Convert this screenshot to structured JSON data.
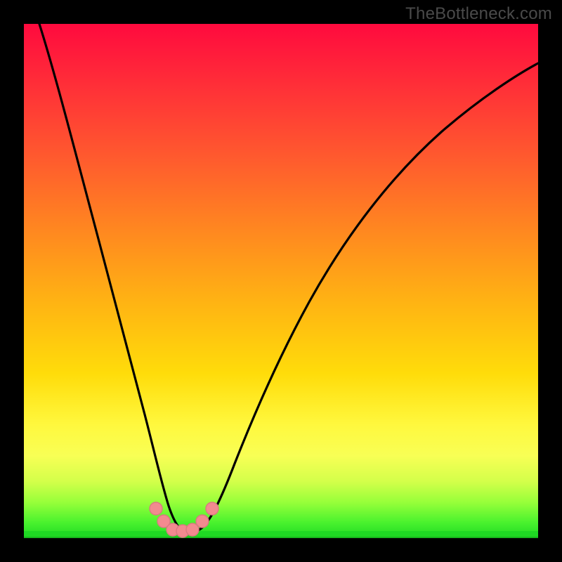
{
  "attribution": "TheBottleneck.com",
  "colors": {
    "frame": "#000000",
    "curve": "#000000",
    "marker_fill": "#f28a8f",
    "marker_stroke": "#c06a6f",
    "gradient_stops": [
      "#ff0a3e",
      "#ff4433",
      "#ff7e26",
      "#ffb31a",
      "#ffe40d",
      "#fff95a",
      "#e8ff4d",
      "#9cff3a",
      "#29e82e"
    ],
    "bottom_accent": "#1fd923"
  },
  "chart_data": {
    "type": "line",
    "title": "",
    "xlabel": "",
    "ylabel": "",
    "xlim": [
      0,
      100
    ],
    "ylim": [
      0,
      100
    ],
    "background": "red-yellow-green vertical gradient",
    "series": [
      {
        "name": "bottleneck-curve",
        "x": [
          3,
          5,
          8,
          11,
          14,
          17,
          20,
          22,
          24,
          25.5,
          27,
          28.3,
          29,
          30,
          31.5,
          33,
          36,
          40,
          45,
          52,
          60,
          70,
          82,
          95,
          100
        ],
        "y": [
          100,
          90,
          77,
          64,
          51,
          39,
          27,
          18,
          11,
          6,
          3,
          1.5,
          0.8,
          0.8,
          1.5,
          3,
          8,
          15,
          25,
          38,
          50,
          62,
          72,
          78,
          80
        ]
      }
    ],
    "markers": {
      "name": "optimal-zone-markers",
      "points": [
        {
          "x": 25.2,
          "y": 5.2
        },
        {
          "x": 26.6,
          "y": 2.6
        },
        {
          "x": 28.3,
          "y": 1.0
        },
        {
          "x": 30.0,
          "y": 1.0
        },
        {
          "x": 31.4,
          "y": 2.4
        },
        {
          "x": 33.5,
          "y": 5.0
        }
      ],
      "radius": 9
    },
    "annotations": []
  }
}
